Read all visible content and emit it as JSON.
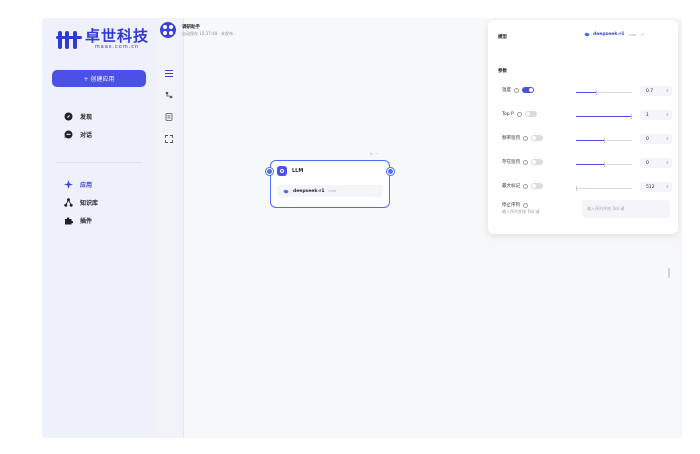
{
  "brand": {
    "name": "卓世科技",
    "sub": "maas.com.cn",
    "color": "#2f3ad6"
  },
  "sidebar": {
    "create_label": "+ 创建应用",
    "items": [
      {
        "label": "发现",
        "icon": "compass-icon"
      },
      {
        "label": "对话",
        "icon": "chat-bubble-icon"
      },
      {
        "label": "应用",
        "icon": "sparkle-icon",
        "active": true
      },
      {
        "label": "知识库",
        "icon": "network-icon"
      },
      {
        "label": "插件",
        "icon": "puzzle-icon"
      }
    ]
  },
  "rail": {
    "icons": [
      "list-icon",
      "branch-icon",
      "document-icon",
      "expand-icon"
    ]
  },
  "header": {
    "title": "调研助手",
    "subtitle": "自动保存 15:37:48 · 未发布"
  },
  "node": {
    "title": "LLM",
    "model": "deepseek-r1",
    "model_tag": "CHAT",
    "tools": "▷ ···"
  },
  "panel": {
    "model_label": "模型",
    "model_value": "deepseek-r1",
    "model_tag": "CHAT",
    "params_label": "参数",
    "params": [
      {
        "label": "温度",
        "enabled": true,
        "value": "0.7",
        "fraction": 0.35
      },
      {
        "label": "Top P",
        "enabled": false,
        "value": "1",
        "fraction": 1.0
      },
      {
        "label": "频率惩罚",
        "enabled": false,
        "value": "0",
        "fraction": 0.5
      },
      {
        "label": "存在惩罚",
        "enabled": false,
        "value": "0",
        "fraction": 0.5
      },
      {
        "label": "最大标记",
        "enabled": false,
        "value": "512",
        "fraction": 0.0
      }
    ],
    "stop_label": "停止序列",
    "stop_hint": "输入序列并按 Tab 键",
    "stop_placeholder": "输入序列并按 Tab 键"
  },
  "colors": {
    "accent": "#4b50e6",
    "node_border": "#4b70f5"
  }
}
